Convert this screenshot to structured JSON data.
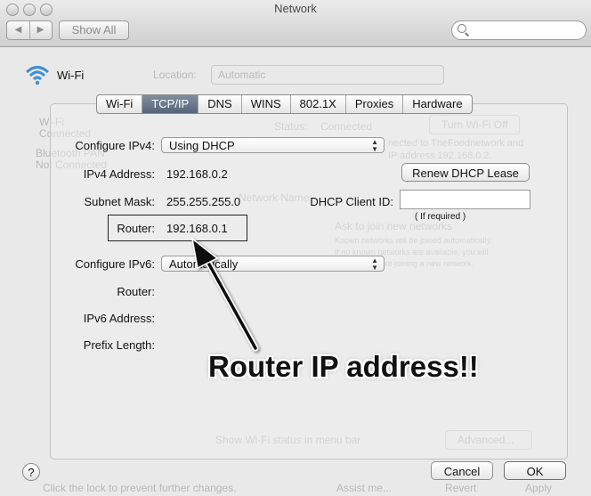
{
  "window": {
    "title": "Network"
  },
  "toolbar": {
    "back_glyph": "◀",
    "forward_glyph": "▶",
    "show_all_label": "Show All",
    "search_placeholder": ""
  },
  "background": {
    "location_label": "Location:",
    "location_value": "Automatic",
    "sidebar_item_1": "Wi-Fi",
    "sidebar_item_1_status": "Connected",
    "sidebar_item_2": "Bluetooth PAN",
    "sidebar_item_2_status": "Not Connected",
    "status_label": "Status:",
    "status_value": "Connected",
    "turn_wifi_off_label": "Turn Wi-Fi Off",
    "status_desc_1": "nected to TheFoodnetwork and",
    "status_desc_2": "IP address 192.168.0.2.",
    "network_name_label": "Network Name:",
    "ask_join_label": "Ask to join new networks",
    "ask_join_desc_1": "Known networks will be joined automatically.",
    "ask_join_desc_2": "If no known networks are available, you will",
    "ask_join_desc_3": "be asked before joining a new network.",
    "show_status_label": "Show Wi-Fi status in menu bar",
    "advanced_label": "Advanced...",
    "lock_text": "Click the lock to prevent further changes.",
    "assist_label": "Assist me...",
    "revert_label": "Revert",
    "apply_label": "Apply"
  },
  "sheet": {
    "interface_name": "Wi-Fi",
    "tabs": [
      {
        "label": "Wi-Fi",
        "active": false
      },
      {
        "label": "TCP/IP",
        "active": true
      },
      {
        "label": "DNS",
        "active": false
      },
      {
        "label": "WINS",
        "active": false
      },
      {
        "label": "802.1X",
        "active": false
      },
      {
        "label": "Proxies",
        "active": false
      },
      {
        "label": "Hardware",
        "active": false
      }
    ],
    "configure_ipv4_label": "Configure IPv4:",
    "configure_ipv4_value": "Using DHCP",
    "ipv4_address_label": "IPv4 Address:",
    "ipv4_address_value": "192.168.0.2",
    "subnet_mask_label": "Subnet Mask:",
    "subnet_mask_value": "255.255.255.0",
    "router_label": "Router:",
    "router_value": "192.168.0.1",
    "renew_dhcp_label": "Renew DHCP Lease",
    "dhcp_client_id_label": "DHCP Client ID:",
    "dhcp_client_id_value": "",
    "dhcp_hint": "( If required )",
    "configure_ipv6_label": "Configure IPv6:",
    "configure_ipv6_value": "Automatically",
    "ipv6_router_label": "Router:",
    "ipv6_address_label": "IPv6 Address:",
    "prefix_length_label": "Prefix Length:",
    "help_glyph": "?",
    "cancel_label": "Cancel",
    "ok_label": "OK"
  },
  "annotation": {
    "text": "Router IP address!!"
  },
  "colors": {
    "active_tab": "#5f6f84",
    "annotation_text": "#111111"
  }
}
